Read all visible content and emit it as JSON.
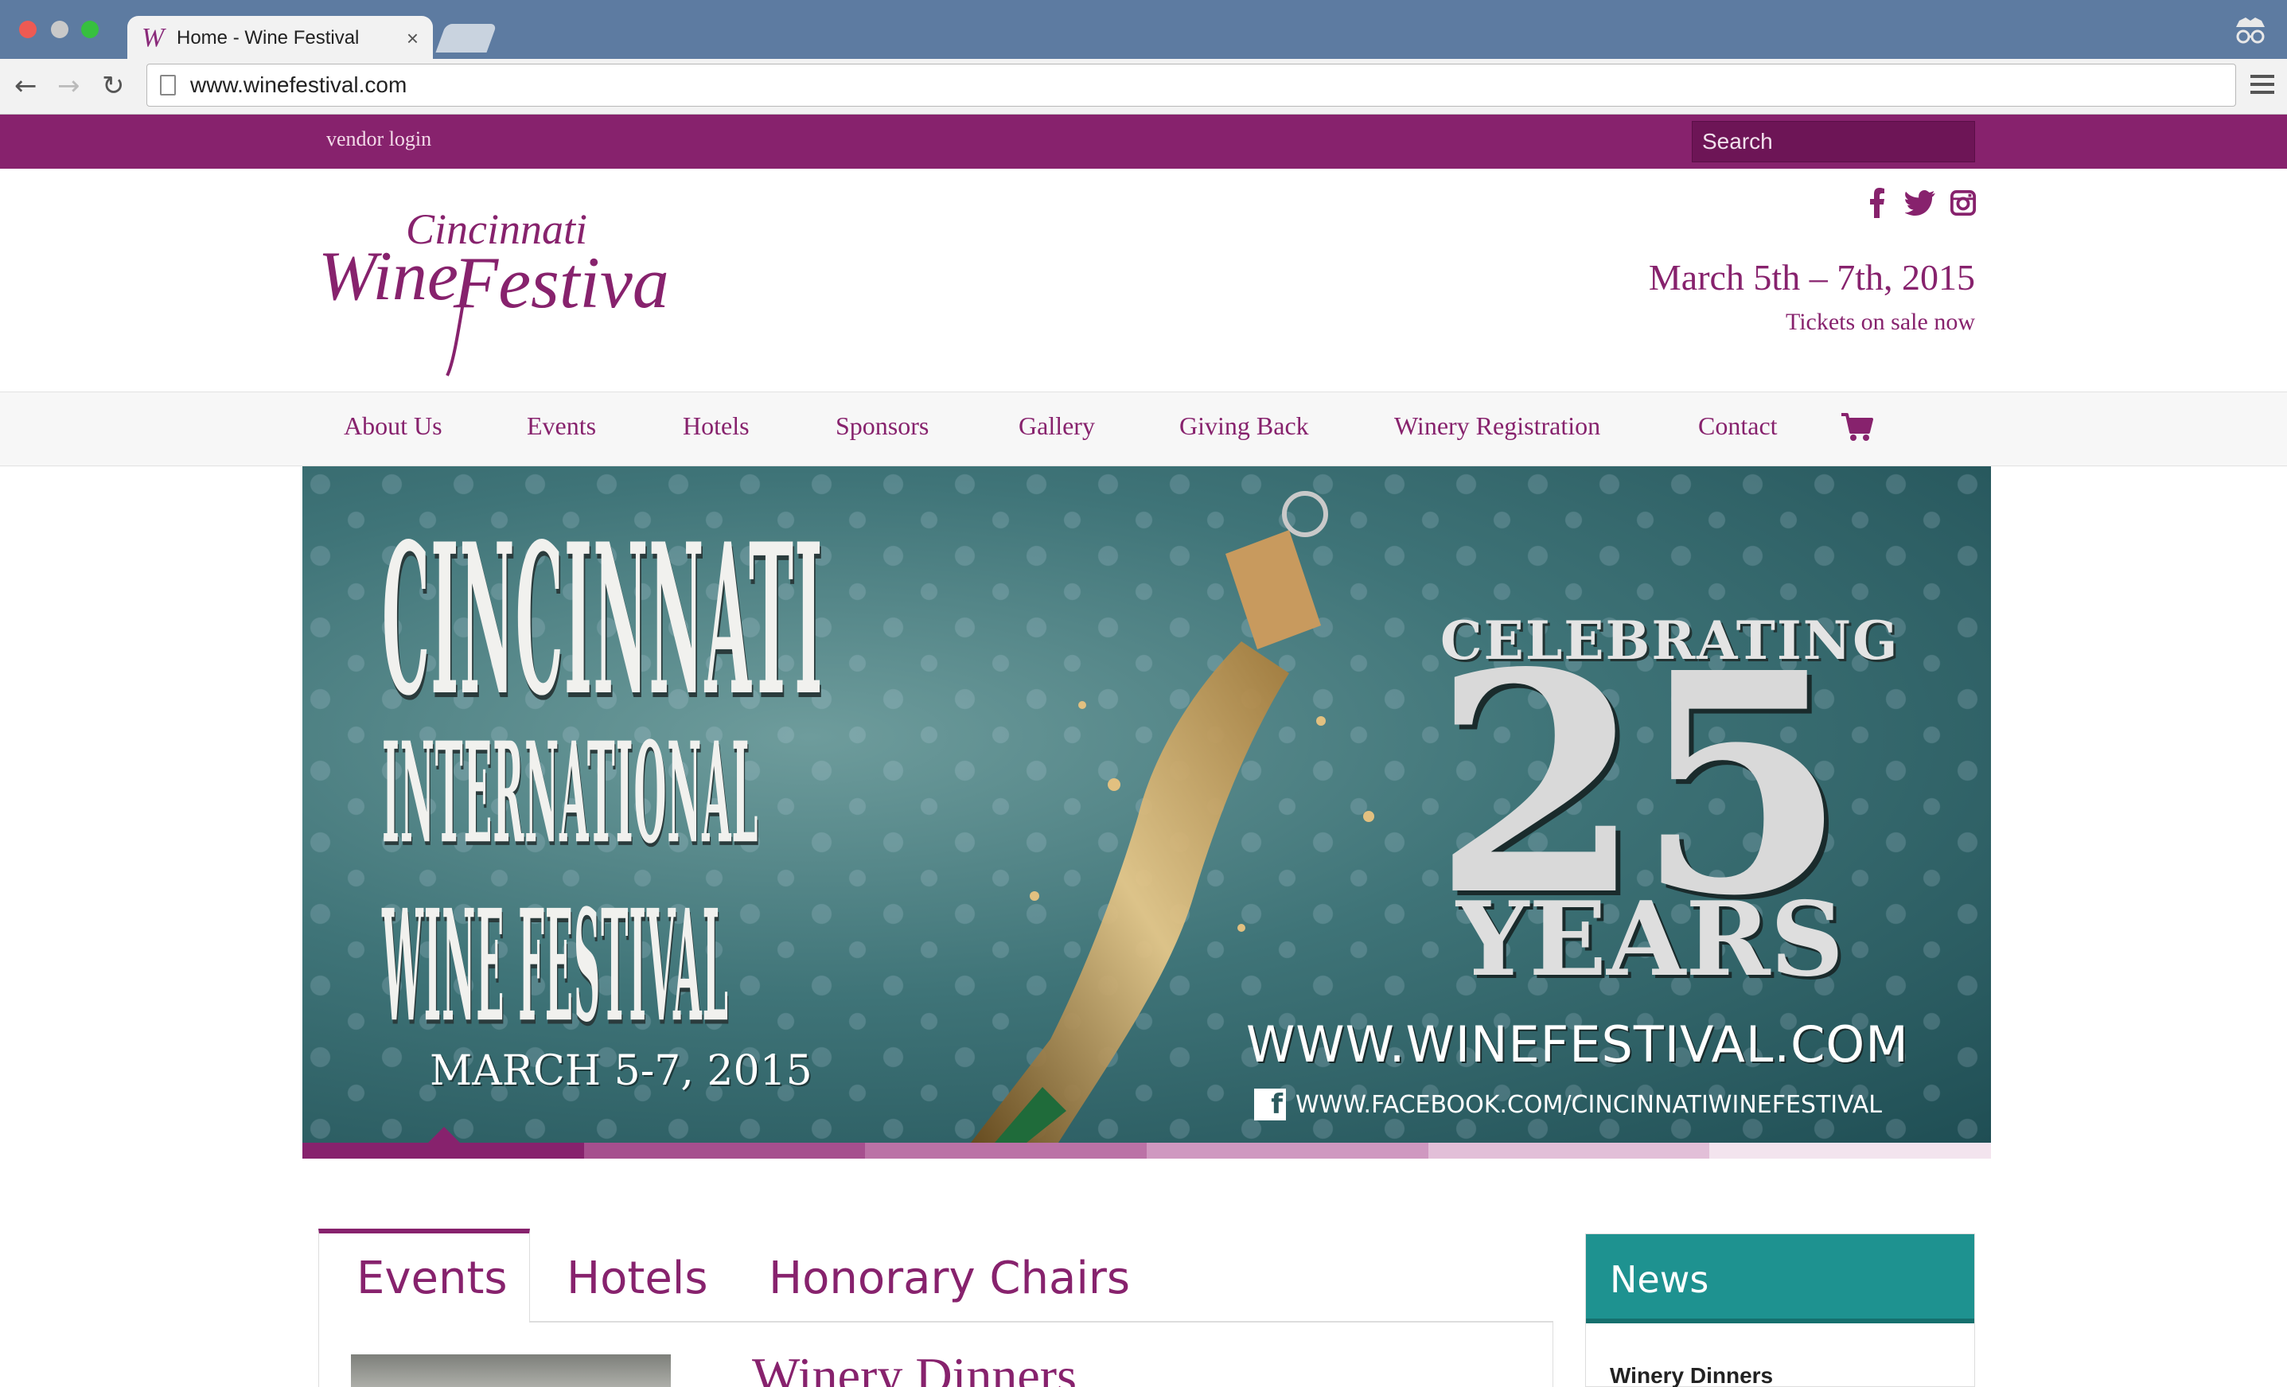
{
  "browser": {
    "tab_title": "Home - Wine Festival",
    "tab_favicon": "W",
    "tab_close": "×",
    "url": "www.winefestival.com",
    "back_icon": "←",
    "forward_icon": "→",
    "reload_icon": "↻"
  },
  "topbar": {
    "vendor_login": "vendor login",
    "search_placeholder": "Search"
  },
  "header": {
    "logo_line1": "Cincinnati",
    "logo_line2": "Wine",
    "logo_line3": "Festival",
    "dates": "March 5th – 7th, 2015",
    "tickets": "Tickets on sale now"
  },
  "nav": {
    "items": [
      "About Us",
      "Events",
      "Hotels",
      "Sponsors",
      "Gallery",
      "Giving Back",
      "Winery Registration",
      "Contact"
    ]
  },
  "banner": {
    "line1": "CINCINNATI",
    "line2": "INTERNATIONAL",
    "line3": "WINE FESTIVAL",
    "date": "MARCH 5-7, 2015",
    "celebrating": "CELEBRATING",
    "number": "25",
    "years": "YEARS",
    "url": "WWW.WINEFESTIVAL.COM",
    "facebook": "WWW.FACEBOOK.COM/CINCINNATIWINEFESTIVAL",
    "fb_letter": "f"
  },
  "slider": {
    "colors": [
      "#87226d",
      "#a64f8e",
      "#bb72a6",
      "#cf98c0",
      "#e2bfd8",
      "#f3e4ee"
    ]
  },
  "content_tabs": {
    "tabs": [
      "Events",
      "Hotels",
      "Honorary Chairs"
    ],
    "active": "Events",
    "panel_title": "Winery Dinners"
  },
  "news": {
    "title": "News",
    "first_item": "Winery Dinners"
  },
  "colors": {
    "brand": "#87226d",
    "news": "#1e9290"
  }
}
